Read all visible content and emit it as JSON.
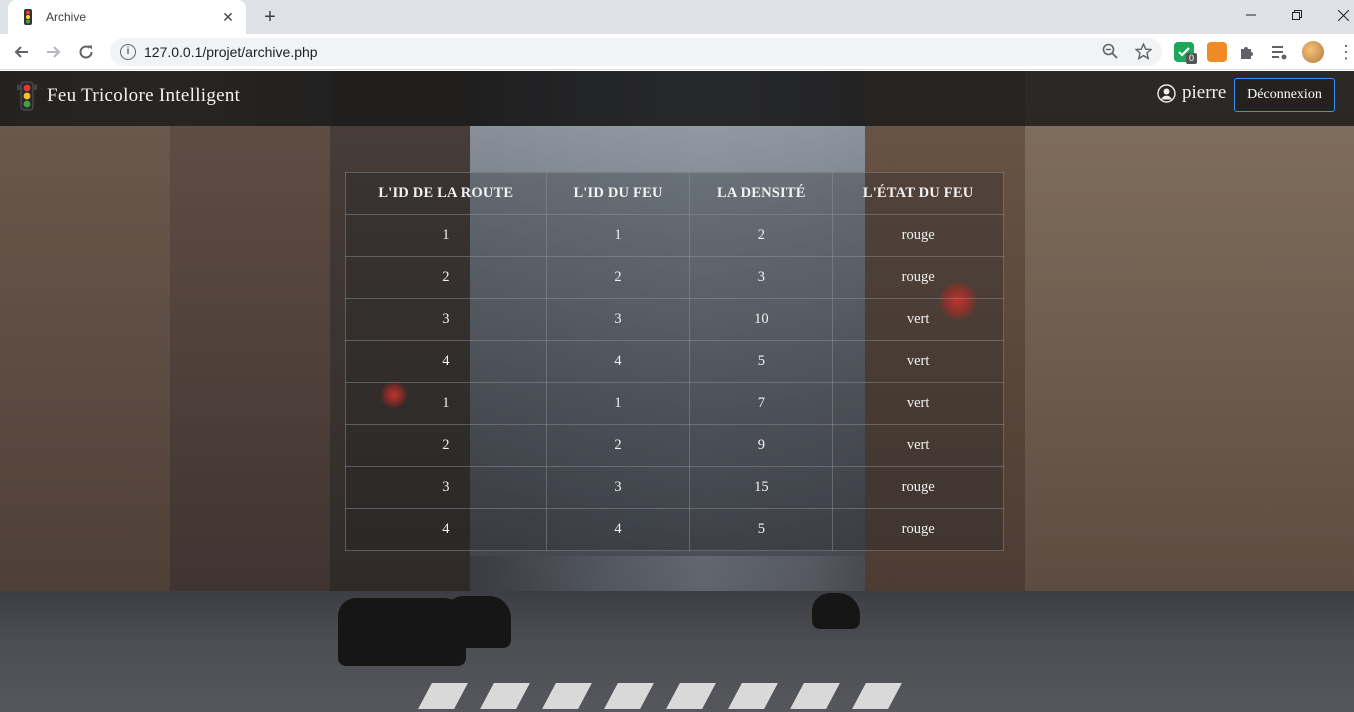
{
  "browser": {
    "tab_title": "Archive",
    "url": "127.0.0.1/projet/archive.php",
    "new_tab_label": "+",
    "extension_badge": "0"
  },
  "site": {
    "brand_name": "Feu Tricolore Intelligent",
    "username": "pierre",
    "logout_label": "Déconnexion"
  },
  "table": {
    "headers": [
      "L'ID DE LA ROUTE",
      "L'ID DU FEU",
      "LA DENSITÉ",
      "L'ÉTAT DU FEU"
    ],
    "rows": [
      [
        "1",
        "1",
        "2",
        "rouge"
      ],
      [
        "2",
        "2",
        "3",
        "rouge"
      ],
      [
        "3",
        "3",
        "10",
        "vert"
      ],
      [
        "4",
        "4",
        "5",
        "vert"
      ],
      [
        "1",
        "1",
        "7",
        "vert"
      ],
      [
        "2",
        "2",
        "9",
        "vert"
      ],
      [
        "3",
        "3",
        "15",
        "rouge"
      ],
      [
        "4",
        "4",
        "5",
        "rouge"
      ]
    ]
  },
  "colors": {
    "nav_background": "#191919",
    "logout_border": "#3b8cff",
    "table_text": "#f2f2f2"
  }
}
